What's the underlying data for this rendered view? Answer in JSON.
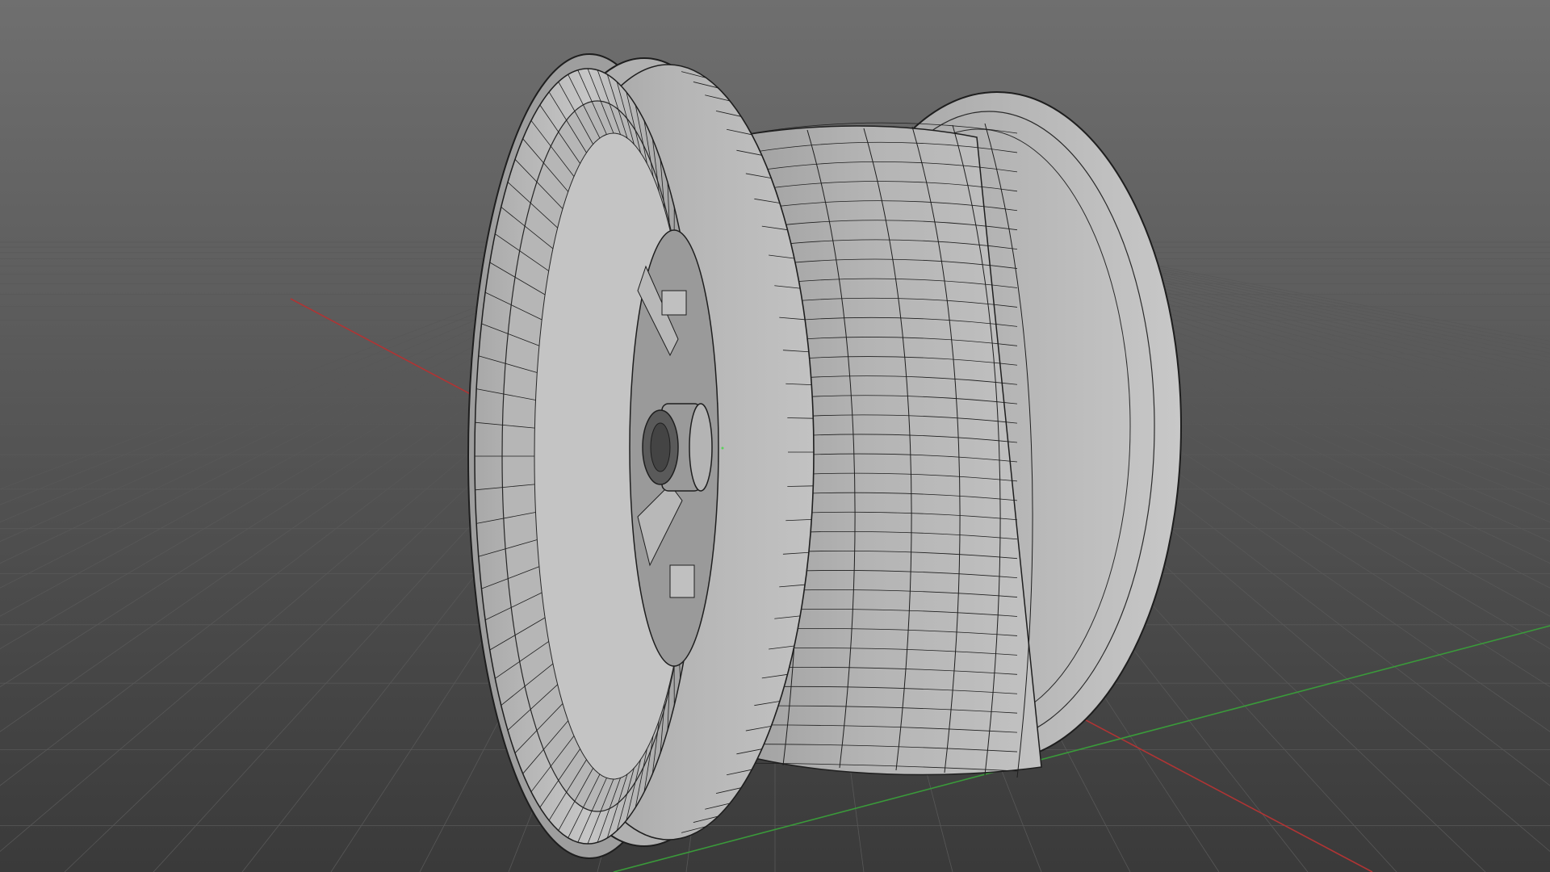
{
  "viewport": {
    "mode": "3D viewport",
    "shading": "solid",
    "overlay": "wireframe",
    "background_top": "#6f6f6f",
    "background_bottom": "#3a3a3a",
    "grid_color": "#585858",
    "axis_x_color": "#b03434",
    "axis_y_color": "#3a9a3a"
  },
  "object": {
    "type": "wheel rim",
    "mesh_color": "#a6a6a6",
    "wire_color": "#1e1e1e"
  }
}
